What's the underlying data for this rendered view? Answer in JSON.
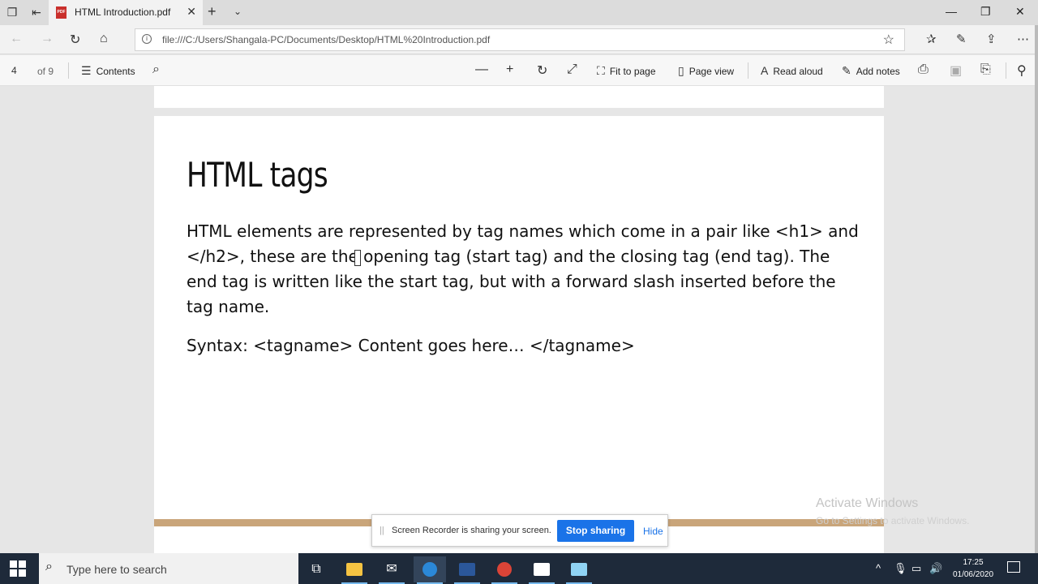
{
  "browser": {
    "tab_title": "HTML Introduction.pdf",
    "url": "file:///C:/Users/Shangala-PC/Documents/Desktop/HTML%20Introduction.pdf"
  },
  "pdf_toolbar": {
    "page_current": "4",
    "page_total": "of 9",
    "contents": "Contents",
    "fit_to_page": "Fit to page",
    "page_view": "Page view",
    "read_aloud": "Read aloud",
    "add_notes": "Add notes"
  },
  "document": {
    "heading": "HTML tags",
    "paragraph": "HTML elements are represented by tag names which come in a pair like <h1> and </h2>, these are the opening tag (start tag) and the closing tag (end tag). The end tag is written like the start tag, but with a forward slash inserted before the tag name.",
    "syntax": "Syntax: <tagname> Content goes here… </tagname>"
  },
  "watermark": {
    "line1": "Activate Windows",
    "line2": "Go to Settings to activate Windows."
  },
  "sharing_bar": {
    "message": "Screen Recorder is sharing your screen.",
    "stop_label": "Stop sharing",
    "hide_label": "Hide"
  },
  "taskbar": {
    "search_placeholder": "Type here to search",
    "time": "17:25",
    "date": "01/06/2020"
  },
  "colors": {
    "accent_blue": "#1a73e8",
    "pdf_rule": "#c9a57a",
    "taskbar": "#1e2a3a"
  }
}
